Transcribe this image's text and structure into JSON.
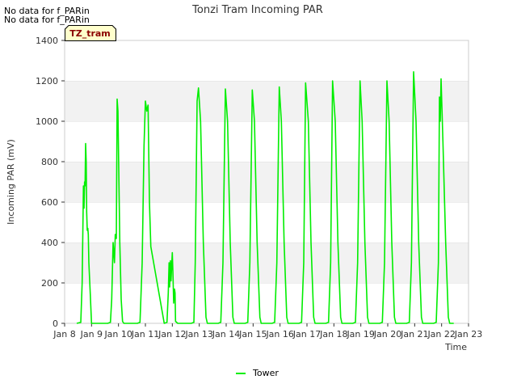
{
  "notices": [
    "No data for f_PARin",
    "No data for f_PARin"
  ],
  "site_badge": "TZ_tram",
  "chart_data": {
    "type": "line",
    "title": "Tonzi Tram Incoming PAR",
    "xlabel": "Time",
    "ylabel": "Incoming PAR (mV)",
    "xlim": [
      8,
      23
    ],
    "ylim": [
      0,
      1400
    ],
    "xticks": [
      8,
      9,
      10,
      11,
      12,
      13,
      14,
      15,
      16,
      17,
      18,
      19,
      20,
      21,
      22,
      23
    ],
    "xtick_labels": [
      "Jan 8",
      "Jan 9",
      "Jan 10",
      "Jan 11",
      "Jan 12",
      "Jan 13",
      "Jan 14",
      "Jan 15",
      "Jan 16",
      "Jan 17",
      "Jan 18",
      "Jan 19",
      "Jan 20",
      "Jan 21",
      "Jan 22",
      "Jan 23"
    ],
    "yticks": [
      0,
      200,
      400,
      600,
      800,
      1000,
      1200,
      1400
    ],
    "grid": "horizontal bands",
    "legend": "bottom-center",
    "series": [
      {
        "name": "Tower",
        "color": "#00ee00",
        "x": [
          8.45,
          8.6,
          8.65,
          8.7,
          8.72,
          8.74,
          8.76,
          8.78,
          8.8,
          8.82,
          8.84,
          8.86,
          8.88,
          8.9,
          8.95,
          9.0,
          9.1,
          9.6,
          9.7,
          9.75,
          9.8,
          9.85,
          9.88,
          9.92,
          9.95,
          9.98,
          10.0,
          10.05,
          10.1,
          10.15,
          10.2,
          10.7,
          10.8,
          10.88,
          10.95,
          11.0,
          11.05,
          11.1,
          11.15,
          11.2,
          11.7,
          11.8,
          11.85,
          11.88,
          11.9,
          11.93,
          11.95,
          11.98,
          12.0,
          12.02,
          12.05,
          12.08,
          12.1,
          12.12,
          12.2,
          12.7,
          12.8,
          12.85,
          12.92,
          12.97,
          13.05,
          13.15,
          13.25,
          13.3,
          13.7,
          13.8,
          13.88,
          13.97,
          14.05,
          14.15,
          14.25,
          14.3,
          14.7,
          14.8,
          14.88,
          14.97,
          15.05,
          15.15,
          15.25,
          15.3,
          15.7,
          15.8,
          15.88,
          15.97,
          16.05,
          16.15,
          16.25,
          16.3,
          16.7,
          16.8,
          16.88,
          16.95,
          17.05,
          17.15,
          17.25,
          17.3,
          17.7,
          17.8,
          17.88,
          17.95,
          18.05,
          18.15,
          18.25,
          18.3,
          18.7,
          18.8,
          18.88,
          18.97,
          19.05,
          19.15,
          19.25,
          19.3,
          19.7,
          19.8,
          19.88,
          19.97,
          20.05,
          20.15,
          20.25,
          20.3,
          20.7,
          20.8,
          20.88,
          20.96,
          21.05,
          21.15,
          21.25,
          21.3,
          21.7,
          21.8,
          21.88,
          21.92,
          21.95,
          21.98,
          22.05,
          22.15,
          22.25,
          22.3,
          22.45
        ],
        "values": [
          0,
          5,
          200,
          680,
          570,
          700,
          680,
          890,
          800,
          550,
          460,
          470,
          440,
          300,
          150,
          0,
          0,
          0,
          5,
          120,
          400,
          300,
          440,
          420,
          1110,
          1050,
          850,
          400,
          120,
          10,
          0,
          0,
          5,
          300,
          880,
          1100,
          1050,
          1080,
          600,
          380,
          0,
          5,
          150,
          300,
          180,
          310,
          210,
          300,
          350,
          260,
          100,
          170,
          150,
          10,
          0,
          0,
          5,
          300,
          1100,
          1165,
          1000,
          400,
          30,
          0,
          0,
          5,
          300,
          1160,
          1000,
          400,
          30,
          0,
          0,
          5,
          300,
          1155,
          1000,
          400,
          30,
          0,
          0,
          5,
          300,
          1170,
          1000,
          400,
          30,
          0,
          0,
          5,
          300,
          1190,
          1000,
          400,
          30,
          0,
          0,
          5,
          300,
          1200,
          1000,
          400,
          30,
          0,
          0,
          5,
          300,
          1200,
          1000,
          400,
          30,
          0,
          0,
          5,
          300,
          1200,
          1000,
          400,
          30,
          0,
          0,
          5,
          300,
          1245,
          1000,
          400,
          30,
          0,
          0,
          5,
          300,
          1120,
          1000,
          1210,
          900,
          400,
          30,
          0,
          0
        ]
      }
    ]
  }
}
